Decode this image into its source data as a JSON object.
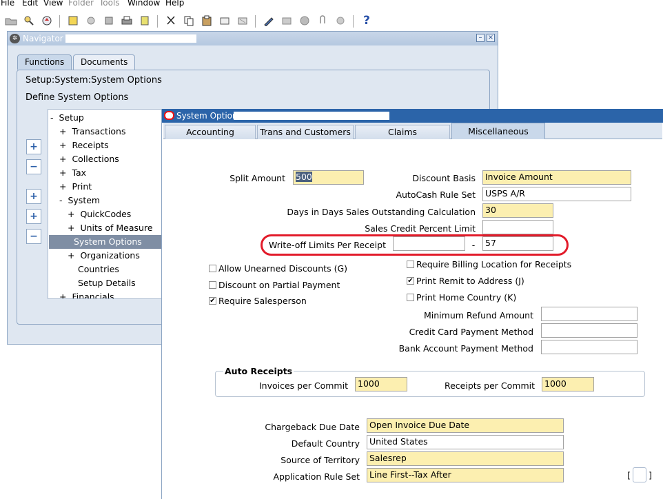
{
  "menu": {
    "file": "File",
    "edit": "Edit",
    "view": "View",
    "folder": "Folder",
    "tools": "Tools",
    "window": "Window",
    "help": "Help"
  },
  "toolbar": {
    "icons": [
      "open-folder-icon",
      "find-icon",
      "navigate-icon",
      "save-icon",
      "new-icon",
      "clear-icon",
      "print-icon",
      "export-icon",
      "cut-icon",
      "copy-icon",
      "paste-icon",
      "edit-icon",
      "delete-icon",
      "translate-icon",
      "zoom-icon",
      "attach-icon",
      "folder-tools-icon",
      "help-icon"
    ],
    "help_glyph": "?"
  },
  "navigator": {
    "title": "Navigator -",
    "tabs": [
      "Functions",
      "Documents"
    ],
    "path": "Setup:System:System Options",
    "function_name": "Define System Options",
    "tree": [
      {
        "prefix": "-",
        "label": "Setup"
      },
      {
        "prefix": "+",
        "label": "Transactions"
      },
      {
        "prefix": "+",
        "label": "Receipts"
      },
      {
        "prefix": "+",
        "label": "Collections"
      },
      {
        "prefix": "+",
        "label": "Tax"
      },
      {
        "prefix": "+",
        "label": "Print"
      },
      {
        "prefix": "-",
        "label": "System"
      },
      {
        "prefix": "+",
        "label": "QuickCodes"
      },
      {
        "prefix": "+",
        "label": "Units of Measure"
      },
      {
        "prefix": "",
        "label": "System Options"
      },
      {
        "prefix": "+",
        "label": "Organizations"
      },
      {
        "prefix": "",
        "label": "Countries"
      },
      {
        "prefix": "",
        "label": "Setup Details"
      },
      {
        "prefix": "+",
        "label": "Financials"
      }
    ],
    "side_buttons": [
      "+",
      "−",
      "+",
      "+",
      "−"
    ]
  },
  "system_options": {
    "title": "System Options",
    "tabs": [
      "Accounting",
      "Trans and Customers",
      "Claims",
      "Miscellaneous"
    ],
    "fields": {
      "split_amount_label": "Split Amount",
      "split_amount": "500",
      "discount_basis_label": "Discount Basis",
      "discount_basis": "Invoice Amount",
      "autocash_label": "AutoCash Rule Set",
      "autocash": "USPS A/R",
      "dso_label": "Days in Days Sales Outstanding Calculation",
      "dso": "30",
      "sales_credit_label": "Sales Credit Percent Limit",
      "sales_credit": "",
      "writeoff_label": "Write-off Limits Per Receipt",
      "writeoff_from": "",
      "writeoff_dash": "-",
      "writeoff_to": "57"
    },
    "checkboxes": {
      "allow_unearned": "Allow Unearned Discounts (G)",
      "discount_partial": "Discount on Partial Payment",
      "require_salesperson": "Require Salesperson",
      "require_billing": "Require Billing Location for Receipts",
      "print_remit": "Print Remit to Address (J)",
      "print_home": "Print Home Country (K)",
      "check_mark": "✔"
    },
    "refund": {
      "min_refund_label": "Minimum Refund Amount",
      "credit_card_label": "Credit Card Payment Method",
      "bank_account_label": "Bank Account Payment Method"
    },
    "auto_receipts": {
      "title": "Auto Receipts",
      "invoices_label": "Invoices per Commit",
      "invoices": "1000",
      "receipts_label": "Receipts per Commit",
      "receipts": "1000"
    },
    "bottom": {
      "chargeback_label": "Chargeback Due Date",
      "chargeback": "Open Invoice Due Date",
      "default_country_label": "Default Country",
      "default_country": "United States",
      "territory_label": "Source of Territory",
      "territory": "Salesrep",
      "app_rule_label": "Application Rule Set",
      "app_rule": "Line First--Tax After",
      "bracket_left": "[",
      "bracket_right": "]"
    }
  },
  "colors": {
    "required_field": "#fcefb0",
    "title_bar": "#2b64a9",
    "highlight_ring": "#e21b2a"
  }
}
